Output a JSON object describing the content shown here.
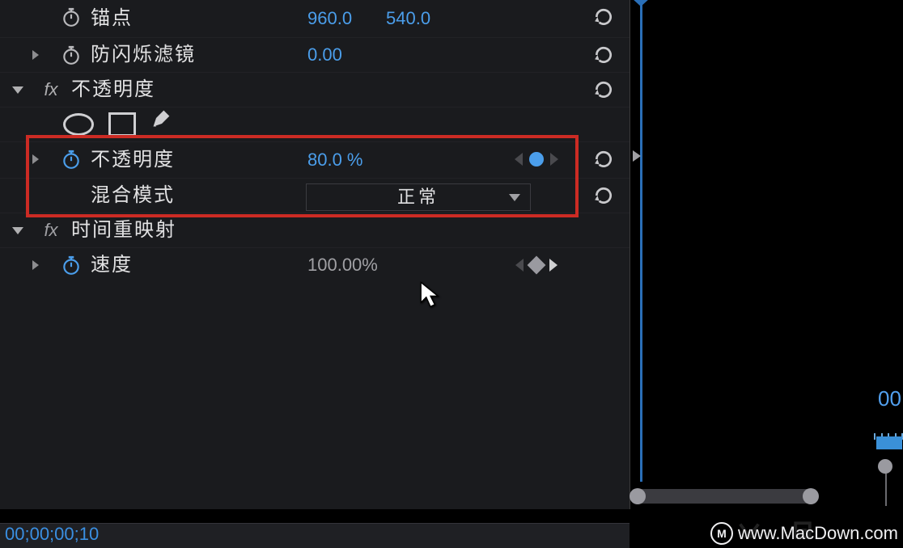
{
  "rows": {
    "anchor": {
      "label": "锚点",
      "x": "960.0",
      "y": "540.0"
    },
    "antiflicker": {
      "label": "防闪烁滤镜",
      "val": "0.00"
    },
    "opacity_group": {
      "label": "不透明度"
    },
    "opacity": {
      "label": "不透明度",
      "val": "80.0 %"
    },
    "blend": {
      "label": "混合模式",
      "val": "正常"
    },
    "timeremap_group": {
      "label": "时间重映射"
    },
    "speed": {
      "label": "速度",
      "val": "100.00%"
    }
  },
  "timecode": "00;00;00;10",
  "timeline_label": "00",
  "watermark": "www.MacDown.com"
}
